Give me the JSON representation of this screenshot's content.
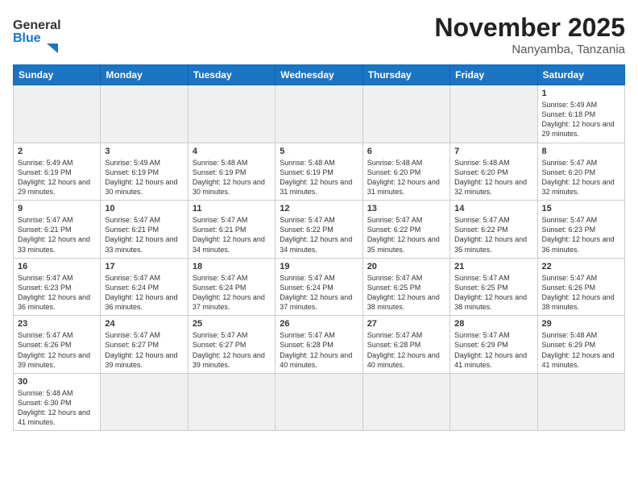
{
  "header": {
    "logo_general": "General",
    "logo_blue": "Blue",
    "month_title": "November 2025",
    "location": "Nanyamba, Tanzania"
  },
  "weekdays": [
    "Sunday",
    "Monday",
    "Tuesday",
    "Wednesday",
    "Thursday",
    "Friday",
    "Saturday"
  ],
  "days": [
    {
      "date": 1,
      "sunrise": "5:49 AM",
      "sunset": "6:18 PM",
      "daylight": "12 hours and 29 minutes."
    },
    {
      "date": 2,
      "sunrise": "5:49 AM",
      "sunset": "6:19 PM",
      "daylight": "12 hours and 29 minutes."
    },
    {
      "date": 3,
      "sunrise": "5:49 AM",
      "sunset": "6:19 PM",
      "daylight": "12 hours and 30 minutes."
    },
    {
      "date": 4,
      "sunrise": "5:48 AM",
      "sunset": "6:19 PM",
      "daylight": "12 hours and 30 minutes."
    },
    {
      "date": 5,
      "sunrise": "5:48 AM",
      "sunset": "6:19 PM",
      "daylight": "12 hours and 31 minutes."
    },
    {
      "date": 6,
      "sunrise": "5:48 AM",
      "sunset": "6:20 PM",
      "daylight": "12 hours and 31 minutes."
    },
    {
      "date": 7,
      "sunrise": "5:48 AM",
      "sunset": "6:20 PM",
      "daylight": "12 hours and 32 minutes."
    },
    {
      "date": 8,
      "sunrise": "5:47 AM",
      "sunset": "6:20 PM",
      "daylight": "12 hours and 32 minutes."
    },
    {
      "date": 9,
      "sunrise": "5:47 AM",
      "sunset": "6:21 PM",
      "daylight": "12 hours and 33 minutes."
    },
    {
      "date": 10,
      "sunrise": "5:47 AM",
      "sunset": "6:21 PM",
      "daylight": "12 hours and 33 minutes."
    },
    {
      "date": 11,
      "sunrise": "5:47 AM",
      "sunset": "6:21 PM",
      "daylight": "12 hours and 34 minutes."
    },
    {
      "date": 12,
      "sunrise": "5:47 AM",
      "sunset": "6:22 PM",
      "daylight": "12 hours and 34 minutes."
    },
    {
      "date": 13,
      "sunrise": "5:47 AM",
      "sunset": "6:22 PM",
      "daylight": "12 hours and 35 minutes."
    },
    {
      "date": 14,
      "sunrise": "5:47 AM",
      "sunset": "6:22 PM",
      "daylight": "12 hours and 35 minutes."
    },
    {
      "date": 15,
      "sunrise": "5:47 AM",
      "sunset": "6:23 PM",
      "daylight": "12 hours and 36 minutes."
    },
    {
      "date": 16,
      "sunrise": "5:47 AM",
      "sunset": "6:23 PM",
      "daylight": "12 hours and 36 minutes."
    },
    {
      "date": 17,
      "sunrise": "5:47 AM",
      "sunset": "6:24 PM",
      "daylight": "12 hours and 36 minutes."
    },
    {
      "date": 18,
      "sunrise": "5:47 AM",
      "sunset": "6:24 PM",
      "daylight": "12 hours and 37 minutes."
    },
    {
      "date": 19,
      "sunrise": "5:47 AM",
      "sunset": "6:24 PM",
      "daylight": "12 hours and 37 minutes."
    },
    {
      "date": 20,
      "sunrise": "5:47 AM",
      "sunset": "6:25 PM",
      "daylight": "12 hours and 38 minutes."
    },
    {
      "date": 21,
      "sunrise": "5:47 AM",
      "sunset": "6:25 PM",
      "daylight": "12 hours and 38 minutes."
    },
    {
      "date": 22,
      "sunrise": "5:47 AM",
      "sunset": "6:26 PM",
      "daylight": "12 hours and 38 minutes."
    },
    {
      "date": 23,
      "sunrise": "5:47 AM",
      "sunset": "6:26 PM",
      "daylight": "12 hours and 39 minutes."
    },
    {
      "date": 24,
      "sunrise": "5:47 AM",
      "sunset": "6:27 PM",
      "daylight": "12 hours and 39 minutes."
    },
    {
      "date": 25,
      "sunrise": "5:47 AM",
      "sunset": "6:27 PM",
      "daylight": "12 hours and 39 minutes."
    },
    {
      "date": 26,
      "sunrise": "5:47 AM",
      "sunset": "6:28 PM",
      "daylight": "12 hours and 40 minutes."
    },
    {
      "date": 27,
      "sunrise": "5:47 AM",
      "sunset": "6:28 PM",
      "daylight": "12 hours and 40 minutes."
    },
    {
      "date": 28,
      "sunrise": "5:47 AM",
      "sunset": "6:29 PM",
      "daylight": "12 hours and 41 minutes."
    },
    {
      "date": 29,
      "sunrise": "5:48 AM",
      "sunset": "6:29 PM",
      "daylight": "12 hours and 41 minutes."
    },
    {
      "date": 30,
      "sunrise": "5:48 AM",
      "sunset": "6:30 PM",
      "daylight": "12 hours and 41 minutes."
    }
  ],
  "labels": {
    "sunrise": "Sunrise:",
    "sunset": "Sunset:",
    "daylight": "Daylight:"
  }
}
